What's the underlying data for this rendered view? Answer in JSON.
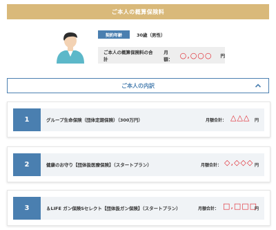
{
  "header": {
    "title": "ご本人の概算保険料"
  },
  "profile": {
    "age_badge": "契約年齢",
    "age_value": "30歳（男性）",
    "total_label": "ご本人の概算保険料の合計",
    "monthly_label": "月額：",
    "total_amount": "○,○○○",
    "yen": "円"
  },
  "details_toggle": {
    "label": "ご本人の内訳"
  },
  "items": [
    {
      "num": "1",
      "name": "グループ生命保険（団体定期保険）（300万円）",
      "monthly_label": "月額合計：",
      "amount": "△△△",
      "yen": "円"
    },
    {
      "num": "2",
      "name": "健康のお守り【団体扱医療保険】（スタートプラン）",
      "monthly_label": "月額合計：",
      "amount": "◇,◇◇◇",
      "yen": "円"
    },
    {
      "num": "3",
      "name": "＆LIFE ガン保険Sセレクト【団体扱ガン保険】（スタートプラン）",
      "monthly_label": "月額合計：",
      "amount": "□,□□□",
      "yen": "円"
    }
  ],
  "colors": {
    "header_bg": "#d9b97a",
    "accent_blue": "#4a7fb0",
    "amount_red": "#e0262e",
    "card_inner_bg": "#f0f3f6"
  }
}
